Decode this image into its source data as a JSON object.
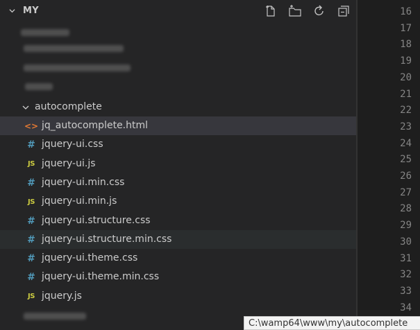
{
  "explorer": {
    "section_title": "MY",
    "toolbar": [
      "new-file-icon",
      "new-folder-icon",
      "refresh-icon",
      "collapse-all-icon"
    ],
    "folder": {
      "name": "autocomplete",
      "expanded": true
    },
    "files": [
      {
        "name": "jq_autocomplete.html",
        "type": "html",
        "glyph": "<>"
      },
      {
        "name": "jquery-ui.css",
        "type": "css",
        "glyph": "#"
      },
      {
        "name": "jquery-ui.js",
        "type": "js",
        "glyph": "JS"
      },
      {
        "name": "jquery-ui.min.css",
        "type": "css",
        "glyph": "#"
      },
      {
        "name": "jquery-ui.min.js",
        "type": "js",
        "glyph": "JS"
      },
      {
        "name": "jquery-ui.structure.css",
        "type": "css",
        "glyph": "#"
      },
      {
        "name": "jquery-ui.structure.min.css",
        "type": "css",
        "glyph": "#"
      },
      {
        "name": "jquery-ui.theme.css",
        "type": "css",
        "glyph": "#"
      },
      {
        "name": "jquery-ui.theme.min.css",
        "type": "css",
        "glyph": "#"
      },
      {
        "name": "jquery.js",
        "type": "js",
        "glyph": "JS"
      }
    ]
  },
  "editor": {
    "line_numbers": [
      "16",
      "17",
      "18",
      "19",
      "20",
      "21",
      "22",
      "23",
      "24",
      "25",
      "26",
      "27",
      "28",
      "29",
      "30",
      "31",
      "32",
      "33",
      "34"
    ]
  },
  "tooltip": {
    "text": "C:\\wamp64\\www\\my\\autocomplete"
  },
  "colors": {
    "sidebar_bg": "#252526",
    "editor_bg": "#1e1e1e",
    "selected_bg": "#37373d",
    "css_icon": "#519aba",
    "js_icon": "#cbcb41",
    "html_icon": "#e37933"
  }
}
